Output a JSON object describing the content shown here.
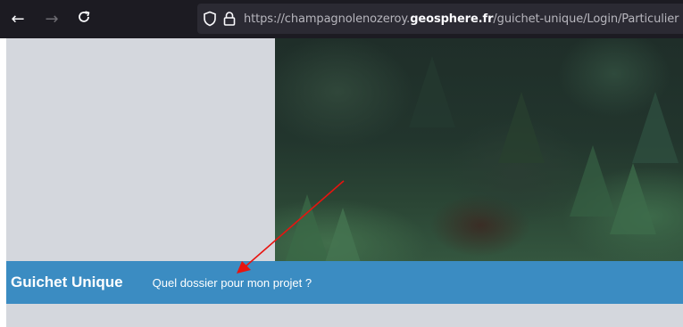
{
  "browser": {
    "url_prefix": "https://champagnolenozeroy.",
    "url_domain": "geosphere.fr",
    "url_path": "/guichet-unique/Login/Particulier",
    "icons": [
      "back-arrow-icon",
      "forward-arrow-icon",
      "reload-icon",
      "shield-icon",
      "lock-icon"
    ]
  },
  "header": {
    "brand": "Guichet Unique",
    "nav_link": "Quel dossier pour mon projet ?"
  },
  "colors": {
    "toolbar_bg": "#1c1b22",
    "urlbar_bg": "#2b2a33",
    "nav_band": "#3b8cc2",
    "panel_gray": "#d4d7dd",
    "annotation_arrow": "#e8140f"
  }
}
